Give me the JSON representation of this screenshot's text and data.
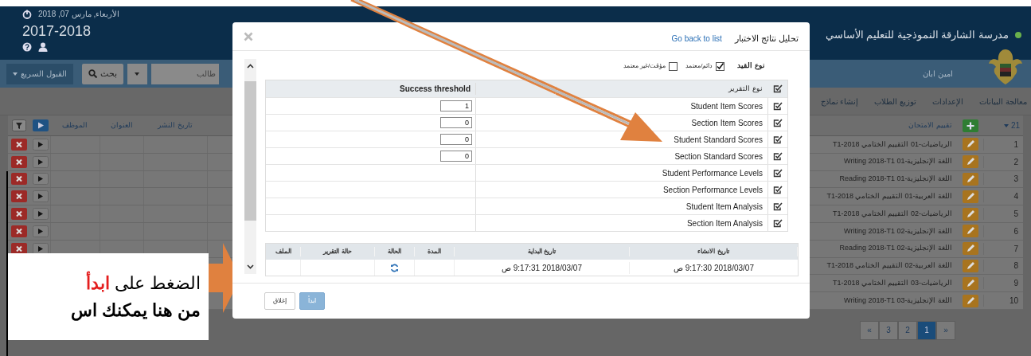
{
  "header": {
    "date": "الأربعاء, مارس 07, 2018",
    "year": "2017-2018",
    "school_name": "مدرسة الشارقة النموذجية للتعليم الأساسي"
  },
  "nav": {
    "quick_admission": "القبول السريع",
    "search_button": "بحث",
    "search_placeholder": "طالب",
    "user_name": "امين ابان"
  },
  "menu": [
    {
      "label": "معالجة البيانات"
    },
    {
      "label": "الإعدادات"
    },
    {
      "label": "توزيع الطلاب"
    },
    {
      "label": "إنشاء نماذج"
    }
  ],
  "table": {
    "count": "21",
    "columns": [
      "تقييم الامتحان",
      "تاريخ النشر",
      "العنوان",
      "الموظف"
    ],
    "rows": [
      {
        "number": "1",
        "name": "الرياضيات-01 التقييم الختامي 2018-T1"
      },
      {
        "number": "2",
        "name": "اللغة الإنجليزية-01 Writing 2018-T1"
      },
      {
        "number": "3",
        "name": "اللغة الإنجليزية-01 Reading 2018-T1"
      },
      {
        "number": "4",
        "name": "اللغة العربية-01 التقييم الختامي 2018-T1"
      },
      {
        "number": "5",
        "name": "الرياضيات-02 التقييم الختامي 2018-T1"
      },
      {
        "number": "6",
        "name": "اللغة الإنجليزية-02 Writing 2018-T1"
      },
      {
        "number": "7",
        "name": "اللغة الإنجليزية-02 Reading 2018-T1"
      },
      {
        "number": "8",
        "name": "اللغة العربية-02 التقييم الختامي 2018-T1"
      },
      {
        "number": "9",
        "name": "الرياضيات-03 التقييم الختامي 2018-T1"
      },
      {
        "number": "10",
        "name": "اللغة الإنجليزية-03 Writing 2018-T1"
      }
    ]
  },
  "pagination": [
    {
      "label": "»",
      "selected": false
    },
    {
      "label": "1",
      "selected": true
    },
    {
      "label": "2",
      "selected": false
    },
    {
      "label": "3",
      "selected": false
    },
    {
      "label": "«",
      "selected": false
    }
  ],
  "modal": {
    "title": "تحليل نتائج الاختبار",
    "back_link": "Go back to list",
    "enrollment_label": "نوع القيد",
    "enrollment_options": [
      {
        "label": "دائم/معتمد",
        "checked": true
      },
      {
        "label": "مؤقت/غير معتمد",
        "checked": false
      }
    ],
    "reports": {
      "columns": [
        "نوع التقرير",
        "Success threshold"
      ],
      "rows": [
        {
          "name": "Student Item Scores",
          "threshold": "1"
        },
        {
          "name": "Section Item Scores",
          "threshold": "0"
        },
        {
          "name": "Student Standard Scores",
          "threshold": "0"
        },
        {
          "name": "Section Standard Scores",
          "threshold": "0"
        },
        {
          "name": "Student Performance Levels"
        },
        {
          "name": "Section Performance Levels"
        },
        {
          "name": "Student Item Analysis"
        },
        {
          "name": "Section Item Analysis"
        }
      ]
    },
    "runs": {
      "columns": [
        "تاريخ الانشاء",
        "تاريخ البداية",
        "المدة",
        "الحالة",
        "حالة التقرير",
        "الملف"
      ],
      "rows": [
        {
          "created": "2018/03/07 9:17:30 ص",
          "started": "2018/03/07 9:17:31 ص"
        }
      ]
    },
    "buttons": [
      {
        "label": "ابدأ",
        "kind": "primary"
      },
      {
        "label": "إغلاق",
        "kind": "default"
      }
    ]
  },
  "callout": {
    "lines": [
      "الضغط على **ابدأ**",
      "من هنا يمكنك اس"
    ]
  }
}
